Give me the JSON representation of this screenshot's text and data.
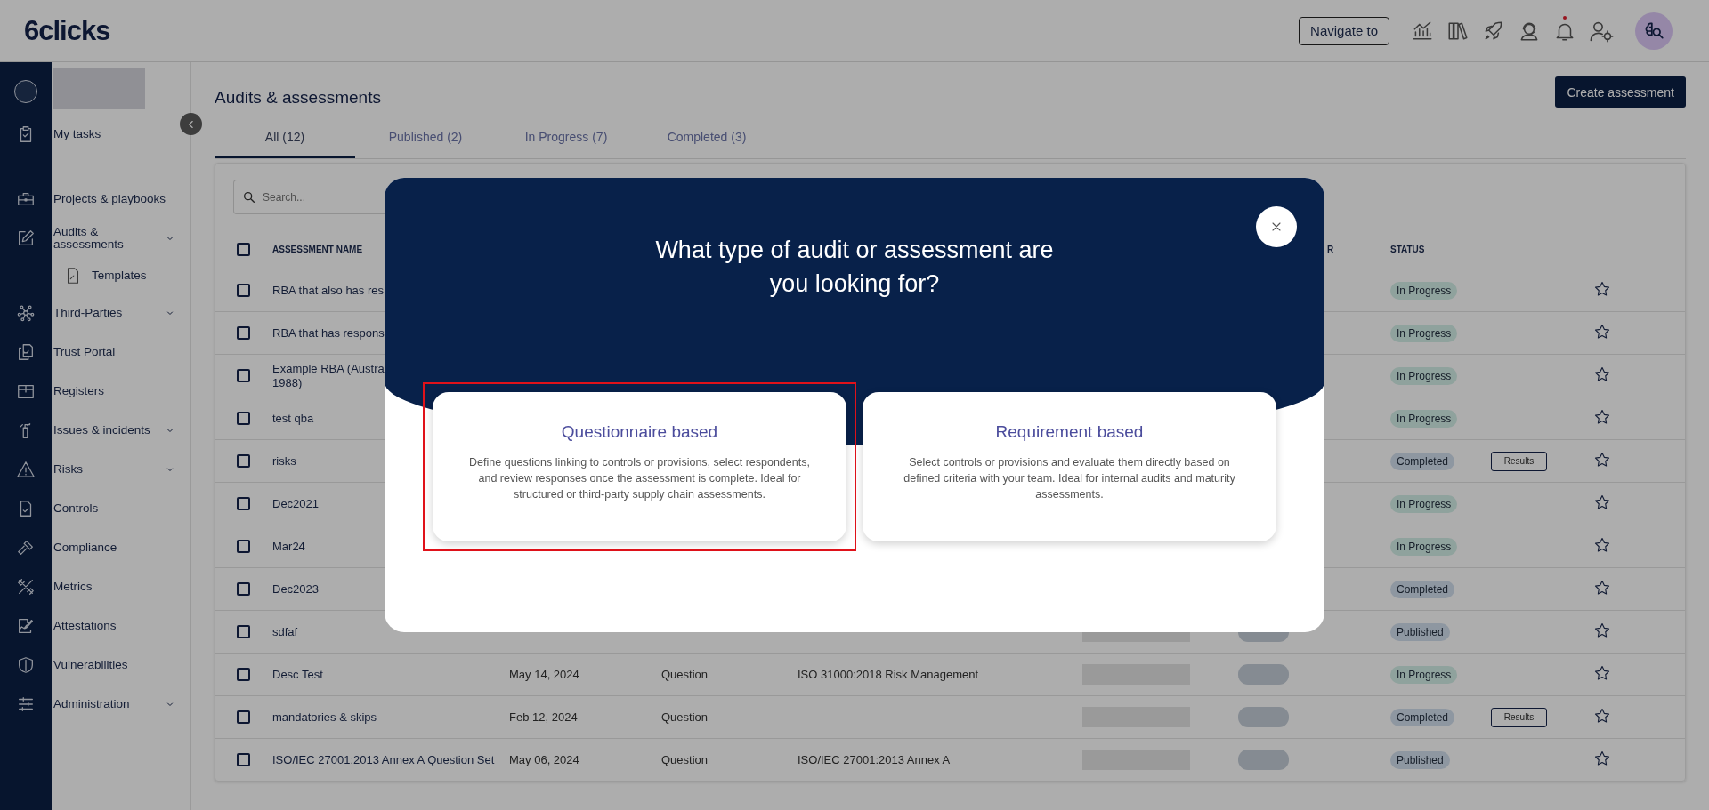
{
  "header": {
    "logo": "6clicks",
    "navigate_button": "Navigate to",
    "has_notification": true
  },
  "sidebar": {
    "sections": [
      {
        "items": [
          {
            "label": "My tasks",
            "kind": "link"
          }
        ]
      },
      {
        "items": [
          {
            "label": "Projects & playbooks",
            "kind": "link"
          },
          {
            "label": "Audits & assessments",
            "kind": "group",
            "children": [
              {
                "label": "Templates",
                "kind": "link"
              }
            ]
          },
          {
            "label": "Third-Parties",
            "kind": "group"
          },
          {
            "label": "Trust Portal",
            "kind": "link"
          },
          {
            "label": "Registers",
            "kind": "link"
          },
          {
            "label": "Issues & incidents",
            "kind": "group"
          },
          {
            "label": "Risks",
            "kind": "group"
          },
          {
            "label": "Controls",
            "kind": "link"
          },
          {
            "label": "Compliance",
            "kind": "link"
          },
          {
            "label": "Metrics",
            "kind": "link"
          },
          {
            "label": "Attestations",
            "kind": "link"
          },
          {
            "label": "Vulnerabilities",
            "kind": "link"
          },
          {
            "label": "Administration",
            "kind": "group"
          }
        ]
      }
    ]
  },
  "page": {
    "title": "Audits & assessments",
    "create_button": "Create assessment"
  },
  "tabs": [
    {
      "label": "All (12)",
      "selected": true
    },
    {
      "label": "Published (2)",
      "selected": false
    },
    {
      "label": "In Progress (7)",
      "selected": false
    },
    {
      "label": "Completed (3)",
      "selected": false
    }
  ],
  "search": {
    "placeholder": "Search..."
  },
  "table": {
    "header_checked": false,
    "columns": [
      "ASSESSMENT NAME",
      "R",
      "STATUS"
    ],
    "rows": [
      {
        "name": "RBA that also has res",
        "checked": false,
        "status": {
          "label": "In Progress",
          "kind": "progress"
        },
        "starred": false
      },
      {
        "name": "RBA that has respons",
        "checked": false,
        "status": {
          "label": "In Progress",
          "kind": "progress"
        },
        "starred": false
      },
      {
        "name": "Example RBA (Austra\n1988)",
        "checked": false,
        "status": {
          "label": "In Progress",
          "kind": "progress"
        },
        "starred": false
      },
      {
        "name": "test qba",
        "checked": false,
        "status": {
          "label": "In Progress",
          "kind": "progress"
        },
        "starred": false
      },
      {
        "name": "risks",
        "checked": false,
        "status": {
          "label": "Completed",
          "kind": "completed"
        },
        "results": "Results",
        "starred": false
      },
      {
        "name": "Dec2021",
        "checked": false,
        "status": {
          "label": "In Progress",
          "kind": "progress"
        },
        "starred": false
      },
      {
        "name": "Mar24",
        "checked": false,
        "status": {
          "label": "In Progress",
          "kind": "progress"
        },
        "starred": false
      },
      {
        "name": "Dec2023",
        "checked": false,
        "status": {
          "label": "Completed",
          "kind": "completed"
        },
        "starred": false
      },
      {
        "name": "sdfaf",
        "checked": false,
        "redacted": true,
        "status": {
          "label": "Published",
          "kind": "published"
        },
        "starred": false
      },
      {
        "name": "Desc Test",
        "checked": false,
        "date": "May 14, 2024",
        "type": "Question",
        "framework": "ISO 31000:2018 Risk Management",
        "redacted": true,
        "status": {
          "label": "In Progress",
          "kind": "progress"
        },
        "starred": false
      },
      {
        "name": "mandatories & skips",
        "checked": false,
        "date": "Feb 12, 2024",
        "type": "Question",
        "redacted": true,
        "status": {
          "label": "Completed",
          "kind": "completed"
        },
        "results": "Results",
        "starred": false
      },
      {
        "name": "ISO/IEC 27001:2013 Annex A Question Set",
        "checked": false,
        "date": "May 06, 2024",
        "type": "Question",
        "framework": "ISO/IEC 27001:2013 Annex A",
        "redacted": true,
        "status": {
          "label": "Published",
          "kind": "published"
        },
        "starred": false
      }
    ]
  },
  "modal": {
    "title": "What type of audit or assessment are you looking for?",
    "options": [
      {
        "title": "Questionnaire based",
        "description": "Define questions linking to controls or provisions, select respondents, and review responses once the assessment is complete. Ideal for structured or third-party supply chain assessments.",
        "selected": true
      },
      {
        "title": "Requirement based",
        "description": "Select controls or provisions and evaluate them directly based on defined criteria with your team. Ideal for internal audits and maturity assessments.",
        "selected": false
      }
    ]
  }
}
